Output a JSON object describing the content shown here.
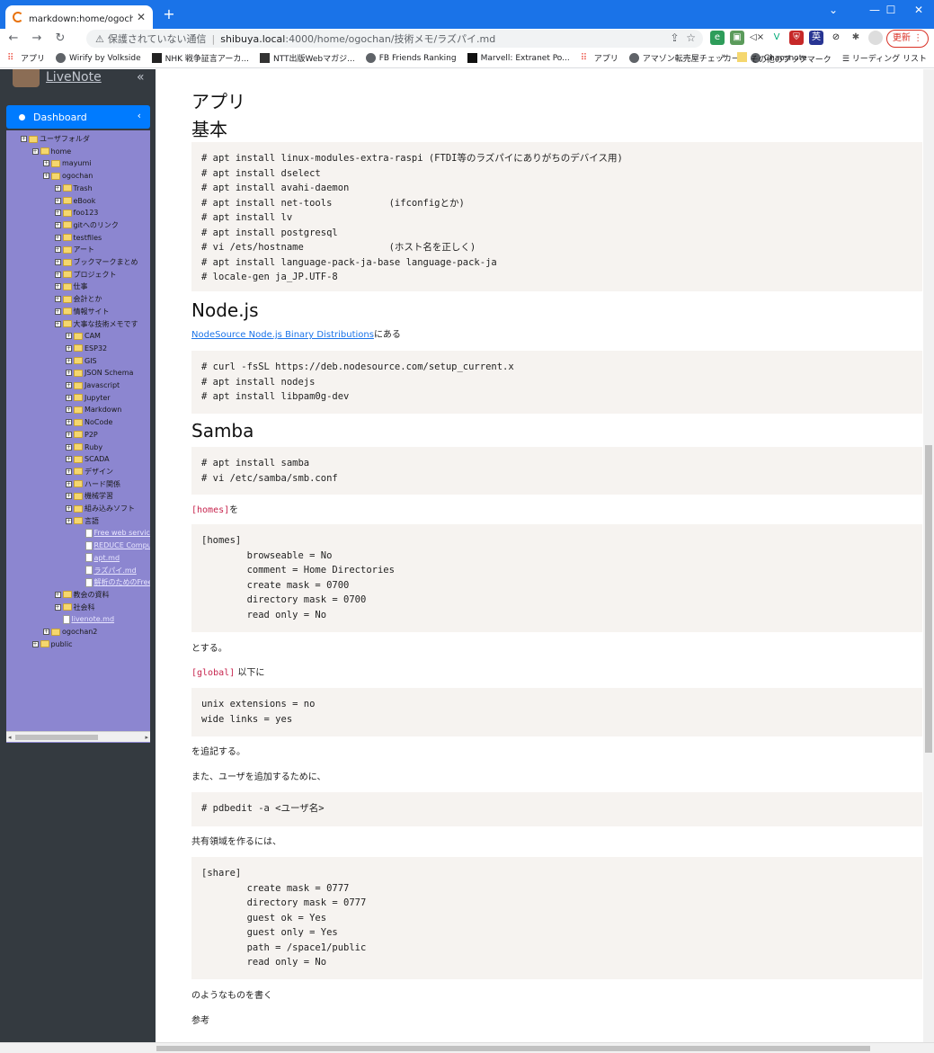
{
  "browser": {
    "tab_title": "markdown:home/ogochan/技術",
    "tab_close": "✕",
    "new_tab": "+",
    "insecure_label": "保護されていない通信",
    "url_host": "shibuya.local",
    "url_path": ":4000/home/ogochan/技術メモ/ラズパイ.md",
    "update_label": "更新",
    "bookmarks": [
      "アプリ",
      "Wirify by Volkside",
      "NHK 戦争証言アーカ...",
      "NTT出版Webマガジ...",
      "FB Friends Ranking",
      "Marvell: Extranet Po...",
      "アプリ",
      "アマゾン転売屋チェッカー",
      "Chaosnote"
    ],
    "bookmarks_other": "その他のブックマーク",
    "bookmarks_reading": "リーディング リスト",
    "more_bookmarks": "»"
  },
  "sidebar": {
    "brand": "LiveNote",
    "dashboard": "Dashboard",
    "tree": [
      {
        "label": "ユーザフォルダ",
        "depth": 0,
        "kind": "folder"
      },
      {
        "label": "home",
        "depth": 1,
        "kind": "folder"
      },
      {
        "label": "mayumi",
        "depth": 2,
        "kind": "folder"
      },
      {
        "label": "ogochan",
        "depth": 2,
        "kind": "folder"
      },
      {
        "label": "Trash",
        "depth": 3,
        "kind": "folder"
      },
      {
        "label": "eBook",
        "depth": 3,
        "kind": "folder"
      },
      {
        "label": "foo123",
        "depth": 3,
        "kind": "folder"
      },
      {
        "label": "gitへのリンク",
        "depth": 3,
        "kind": "folder"
      },
      {
        "label": "testfiles",
        "depth": 3,
        "kind": "folder"
      },
      {
        "label": "アート",
        "depth": 3,
        "kind": "folder"
      },
      {
        "label": "ブックマークまとめ",
        "depth": 3,
        "kind": "folder"
      },
      {
        "label": "プロジェクト",
        "depth": 3,
        "kind": "folder"
      },
      {
        "label": "仕事",
        "depth": 3,
        "kind": "folder"
      },
      {
        "label": "会計とか",
        "depth": 3,
        "kind": "folder"
      },
      {
        "label": "情報サイト",
        "depth": 3,
        "kind": "folder"
      },
      {
        "label": "大事な技術メモです",
        "depth": 3,
        "kind": "folder"
      },
      {
        "label": "CAM",
        "depth": 4,
        "kind": "folder"
      },
      {
        "label": "ESP32",
        "depth": 4,
        "kind": "folder"
      },
      {
        "label": "GIS",
        "depth": 4,
        "kind": "folder"
      },
      {
        "label": "JSON Schema",
        "depth": 4,
        "kind": "folder"
      },
      {
        "label": "Javascript",
        "depth": 4,
        "kind": "folder"
      },
      {
        "label": "Jupyter",
        "depth": 4,
        "kind": "folder"
      },
      {
        "label": "Markdown",
        "depth": 4,
        "kind": "folder"
      },
      {
        "label": "NoCode",
        "depth": 4,
        "kind": "folder"
      },
      {
        "label": "P2P",
        "depth": 4,
        "kind": "folder"
      },
      {
        "label": "Ruby",
        "depth": 4,
        "kind": "folder"
      },
      {
        "label": "SCADA",
        "depth": 4,
        "kind": "folder"
      },
      {
        "label": "デザイン",
        "depth": 4,
        "kind": "folder"
      },
      {
        "label": "ハード関係",
        "depth": 4,
        "kind": "folder"
      },
      {
        "label": "機械学習",
        "depth": 4,
        "kind": "folder"
      },
      {
        "label": "組み込みソフト",
        "depth": 4,
        "kind": "folder"
      },
      {
        "label": "言語",
        "depth": 4,
        "kind": "folder"
      },
      {
        "label": "Free web service",
        "depth": 5,
        "kind": "file"
      },
      {
        "label": "REDUCE Comput",
        "depth": 5,
        "kind": "file"
      },
      {
        "label": "apt.md",
        "depth": 5,
        "kind": "file"
      },
      {
        "label": "ラズパイ.md",
        "depth": 5,
        "kind": "file"
      },
      {
        "label": "解析のためのFreeC",
        "depth": 5,
        "kind": "file"
      },
      {
        "label": "教会の資料",
        "depth": 3,
        "kind": "folder"
      },
      {
        "label": "社会科",
        "depth": 3,
        "kind": "folder"
      },
      {
        "label": "livenote.md",
        "depth": 3,
        "kind": "file"
      },
      {
        "label": "ogochan2",
        "depth": 2,
        "kind": "folder"
      },
      {
        "label": "public",
        "depth": 1,
        "kind": "folder"
      }
    ]
  },
  "doc": {
    "h_app": "アプリ",
    "h_basic": "基本",
    "basic_code": "# apt install linux-modules-extra-raspi (FTDI等のラズパイにありがちのデバイス用)\n# apt install dselect\n# apt install avahi-daemon\n# apt install net-tools          (ifconfigとか)\n# apt install lv\n# apt install postgresql\n# vi /ets/hostname               (ホスト名を正しく)\n# apt install language-pack-ja-base language-pack-ja\n# locale-gen ja_JP.UTF-8",
    "h_node": "Node.js",
    "node_link": "NodeSource Node.js Binary Distributions",
    "node_link_suffix": "にある",
    "node_code": "# curl -fsSL https://deb.nodesource.com/setup_current.x\n# apt install nodejs\n# apt install libpam0g-dev",
    "h_samba": "Samba",
    "samba_code": "# apt install samba\n# vi /etc/samba/smb.conf",
    "homes_inline": "[homes]",
    "homes_suffix": "を",
    "homes_code": "[homes]\n        browseable = No\n        comment = Home Directories\n        create mask = 0700\n        directory mask = 0700\n        read only = No",
    "p_suru": "とする。",
    "global_inline": "[global]",
    "global_suffix": " 以下に",
    "global_code": "unix extensions = no\nwide links = yes",
    "p_tsuiki": "を追記する。",
    "p_user": "また、ユーザを追加するために、",
    "pdb_code": "# pdbedit -a <ユーザ名>",
    "p_share": "共有領域を作るには、",
    "share_code": "[share]\n        create mask = 0777\n        directory mask = 0777\n        guest ok = Yes\n        guest only = Yes\n        path = /space1/public\n        read only = No",
    "p_kaku": "のようなものを書く",
    "p_ref": "参考"
  }
}
